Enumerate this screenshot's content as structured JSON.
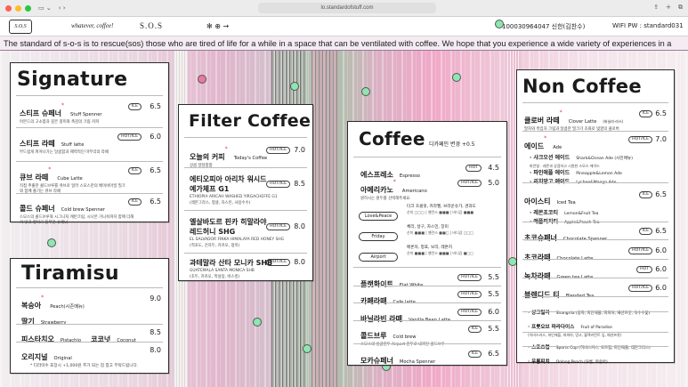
{
  "browser": {
    "url": "lo.standardofstuff.com",
    "colors": {
      "close": "#ff5f57",
      "minimize": "#febc2e",
      "maximize": "#28c840"
    }
  },
  "nav": {
    "logo_text": "S.O.S",
    "items": [
      "whatever, coffee!",
      "S.O.S",
      "✻ ⊕ →",
      "100030964047 신한(김찬수)",
      "WIFI PW : standard031"
    ]
  },
  "ticker": "The standard of s-o-s is to rescue(sos) those who are tired of life for a while in a space that can be ventilated with coffee. We hope that you experience a wide variety of experiences in a",
  "signature": {
    "title": "Signature",
    "items": [
      {
        "ko": "스티프 슈페너",
        "en": "Stuff Spenner",
        "desc": "아몬드의 고소함과 깊은 풍미와 촉감의 크림 커피",
        "tag": "ICE",
        "price": "6.5"
      },
      {
        "ko": "스티프 라떼",
        "en": "Stuff latte",
        "desc": "부드럽게 퍼져나가는 달콤함과 매력적인 마무리의 라떼",
        "tag": "HOT/ICE",
        "price": "6.0"
      },
      {
        "ko": "큐브 라떼",
        "en": "Cube Latte",
        "desc": "직접 추출한 콜드브루를 큐브로 얼려 스모스만의 베이비아일 밀크와 함께 즐기는 큐브 라떼",
        "tag": "ICE",
        "price": "6.5"
      },
      {
        "ko": "콜드 슈페너",
        "en": "Cold brew Spenner",
        "desc": "스모스의 콜드브루와 시그니처 캐빈크림, 시나몬 가니쉬까지 함께 더해져 맛과 향미가 풍부한 슈페너",
        "tag": "ICE",
        "price": "6.5"
      }
    ]
  },
  "tiramisu": {
    "title": "Tiramisu",
    "items": [
      {
        "ko": "복숭아",
        "en": "Peach(시즌메뉴)",
        "price": "9.0"
      },
      {
        "ko": "딸기",
        "en": "Strawberry",
        "price": ""
      },
      {
        "ko": "피스타치오",
        "en": "Pistachio",
        "ko2": "코코넛",
        "en2": "Coconut",
        "price": "8.5"
      },
      {
        "ko": "오리지널",
        "en": "Original",
        "price": "8.0"
      }
    ],
    "note": "* 티라미수 포장시 +1,000원 추가 되는 점 참고 부탁드립니다."
  },
  "filter": {
    "title": "Filter Coffee",
    "items": [
      {
        "ko": "오늘의 커피",
        "en": "Today's Coffee",
        "sub": "상큼 달달함함",
        "tag": "HOT/ICE",
        "price": "7.0"
      },
      {
        "ko": "에티오피아 아리차 워시드",
        "ko2": "예가체프 G1",
        "en": "ETHIOPIA ARICAH WASHED YIRGACHEFFE G1",
        "sub": "(레몬그라스, 청귤, 자스민, 사탕수수)",
        "tag": "HOT/ICE",
        "price": "8.5"
      },
      {
        "ko": "엘살바도르 핀카 히말라야",
        "ko2": "레드허니 SHG",
        "en": "EL SALVADOR FINKA HIMALAYA RED HONEY SHG",
        "sub": "(적포도, 건자두, 카카오, 정미)",
        "tag": "HOT/ICE",
        "price": "8.0"
      },
      {
        "ko": "과테말라 산타 모니카 SHB",
        "en": "GUATEMALA SANTA MONICA SHB",
        "sub": "(초두, 카카오, 흑설탕, 비스킷)",
        "tag": "HOT/ICE",
        "price": "8.0"
      }
    ]
  },
  "coffee": {
    "title": "Coffee",
    "subtitle": "디카페인 변경 +0.5",
    "items": [
      {
        "ko": "에스프레소",
        "en": "Espresso",
        "tag": "HOT",
        "price": "4.5"
      },
      {
        "ko": "아메리카노",
        "en": "Americano",
        "desc": "원하시는 원두를 선택해주세요.",
        "tag": "HOT/ICE",
        "price": "5.0"
      }
    ],
    "beans": [
      {
        "name": "Love&Peace",
        "desc": "다크 초콜릿, 카라멜, 브라운슈가, 견과도",
        "sub": "산미 □□□ | 밸런스 ■■■ | 바디감 ■■■"
      },
      {
        "name": "Friday",
        "desc": "체리, 살구, 자스민, 장미",
        "sub": "산미 ■■■ | 밸런스 ■■□ | 바디감 □□□"
      },
      {
        "name": "Airport",
        "desc": "메론차, 청포, 보리, 레몬치",
        "sub": "산미 ■■■ | 밸런스 ■■■ | 바디감 ■□□"
      }
    ],
    "items2": [
      {
        "ko": "플랫화이트",
        "en": "Flat White",
        "tag": "HOT/ICE",
        "price": "5.5"
      },
      {
        "ko": "카페라떼",
        "en": "Cafe latte",
        "tag": "HOT/ICE",
        "price": "5.5"
      },
      {
        "ko": "바닐라빈 라떼",
        "en": "Vanilla Bean Latte",
        "tag": "HOT/ICE",
        "price": "6.0"
      },
      {
        "ko": "콜드브루",
        "en": "Cold brew",
        "desc": "스모스의 싱글원두 Airport 원두로 내려진 콜드브루",
        "tag": "ICE",
        "price": "5.5"
      },
      {
        "ko": "모카슈페너",
        "en": "Mocha Spenner",
        "tag": "ICE",
        "price": "6.5"
      }
    ]
  },
  "noncoffee": {
    "title": "Non Coffee",
    "items": [
      {
        "ko": "클로버 라떼",
        "en": "Clover Latte",
        "note": "(바닐라·라스)",
        "desc": "말차와 흑임자 크림과 달콤한 밀크가 조화로 빛깔의 클로버",
        "tag": "ICE",
        "price": "6.5"
      },
      {
        "ko": "에이드",
        "en": "Ade",
        "tag": "HOT/ICE",
        "price": "7.0"
      },
      {
        "ko": "· 샤크오션 에이드",
        "en": "Shark&Ocean Ade (사진메뉴)",
        "desc": "파란빛 · 레몬과 상큼하고 시원한 스모스 에이드"
      },
      {
        "ko": "· 파인애플 에이드",
        "en": "Pineapple&Lemon Ade"
      },
      {
        "ko": "· 리치망고 에이드",
        "en": "Lychee&Mango Ade"
      },
      {
        "ko": "아이스티",
        "en": "Iced Tea",
        "tag": "ICE",
        "price": "6.5"
      },
      {
        "ko": "· 레몬초코티",
        "en": "Lemon&Fruit Tea"
      },
      {
        "ko": "· 애플피치티",
        "en": "Apple&Peach Tea"
      },
      {
        "ko": "초코슈페너",
        "en": "Chocolate Spenner",
        "tag": "ICE",
        "price": "6.5"
      },
      {
        "ko": "초코라떼",
        "en": "Chocolate Latte",
        "tag": "HOT/ICE",
        "price": "6.0"
      },
      {
        "ko": "녹차라떼",
        "en": "Green tea Latte",
        "tag": "HOT",
        "price": "6.0"
      },
      {
        "ko": "블렌디드 티",
        "en": "Blended Tea",
        "tag": "HOT/ICE",
        "price": "6.0"
      },
      {
        "ko": "· 샹그릴라",
        "en": "Shangrila (홍차, 파인애플, 파파야, 패션프룻, 옥수수꽃)"
      },
      {
        "ko": "· 프룻오브 파라다이스",
        "en": "Fruit of Paradise",
        "desc": "(히비스커스, 파인애플, 파파야, 망고, 블랙커런트 잎, 패션프룻)"
      },
      {
        "ko": "· 스포츠컵",
        "en": "Sports Cup (히비스커스, 로즈힙, 파인애플, 레몬그라스)"
      },
      {
        "ko": "· 우롱피치",
        "en": "Oolong Peach (우롱, 복숭아)"
      }
    ]
  }
}
